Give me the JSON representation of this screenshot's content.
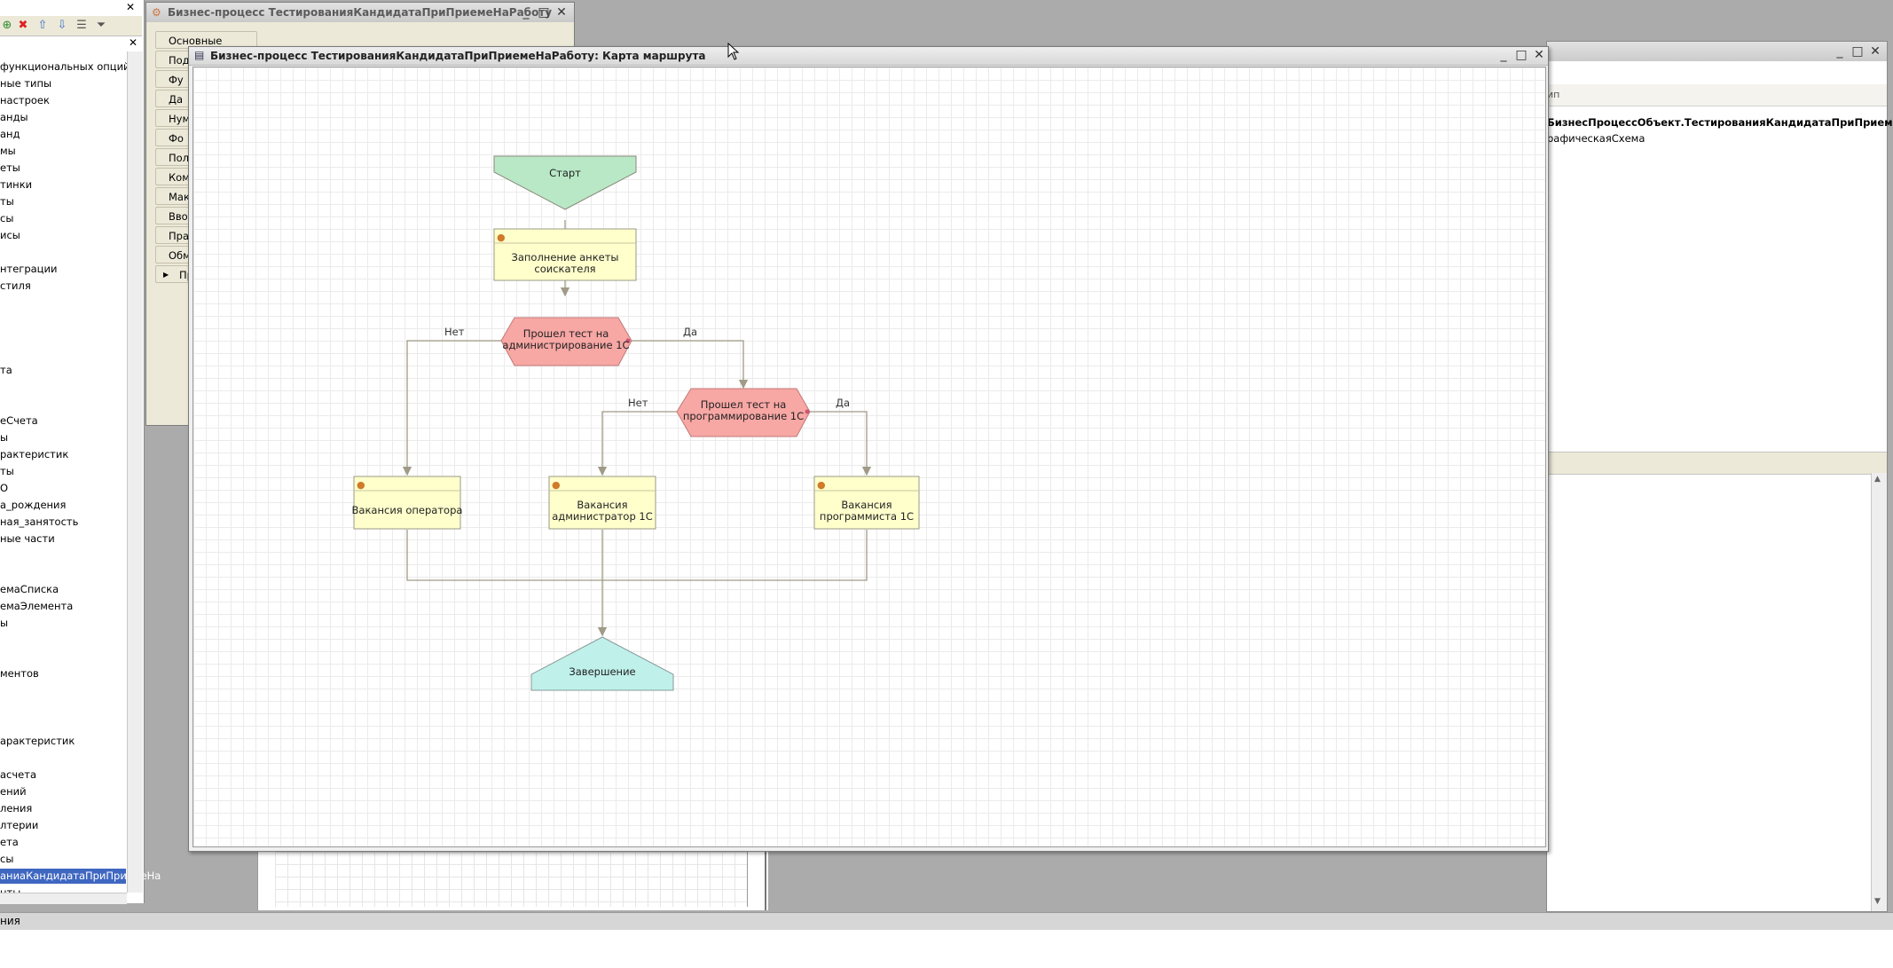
{
  "tree": {
    "items": [
      {
        "label": "функциональных опций"
      },
      {
        "label": "ные типы"
      },
      {
        "label": "настроек"
      },
      {
        "label": "анды"
      },
      {
        "label": "анд"
      },
      {
        "label": "мы"
      },
      {
        "label": "еты"
      },
      {
        "label": "тинки"
      },
      {
        "label": "ты"
      },
      {
        "label": "сы"
      },
      {
        "label": "исы"
      },
      {
        "label": "нтеграции"
      },
      {
        "label": "стиля"
      },
      {
        "label": "та"
      },
      {
        "label": "еСчета"
      },
      {
        "label": "ы"
      },
      {
        "label": "рактеристик"
      },
      {
        "label": "ты"
      },
      {
        "label": "О"
      },
      {
        "label": "а_рождения"
      },
      {
        "label": "ная_занятость"
      },
      {
        "label": "ные части"
      },
      {
        "label": "емаСписка"
      },
      {
        "label": "емаЭлемента"
      },
      {
        "label": "ы"
      },
      {
        "label": "ментов"
      },
      {
        "label": "арактеристик"
      },
      {
        "label": "асчета"
      },
      {
        "label": "ений"
      },
      {
        "label": "ления"
      },
      {
        "label": "лтерии"
      },
      {
        "label": "ета"
      },
      {
        "label": "сы"
      },
      {
        "label": "аниаКандидатаПриПриемеНа"
      },
      {
        "label": "нты"
      }
    ],
    "selected_index": 33
  },
  "status_bar": {
    "text": "ния"
  },
  "bg_window": {
    "title": "Бизнес-процесс ТестированияКандидатаПриПриемеНаРаботу",
    "tabs": [
      "Основные",
      "Под",
      "Фу",
      "Да",
      "Нум",
      "Фо",
      "Пол",
      "Ком",
      "Мак",
      "Вво",
      "Пра",
      "Обм",
      "Про"
    ]
  },
  "right_window": {
    "column_header": "ип",
    "rows": [
      "БизнесПроцессОбъект.ТестированияКандидатаПриПриемеН...",
      "рафическаяСхема"
    ]
  },
  "map_window": {
    "title": "Бизнес-процесс ТестированияКандидатаПриПриемеНаРаботу: Карта маршрута",
    "controls": {
      "minimize": "_",
      "maximize": "□",
      "close": "✕"
    }
  },
  "flowchart": {
    "start": "Старт",
    "fill_form": [
      "Заполнение анкеты",
      "соискателя"
    ],
    "cond_admin": [
      "Прошел тест на",
      "администрирование 1С"
    ],
    "cond_prog": [
      "Прошел тест на",
      "программирование 1С"
    ],
    "operator": "Вакансия оператора",
    "admin_vac": [
      "Вакансия",
      "администратор 1С"
    ],
    "prog_vac": [
      "Вакансия",
      "программиста 1С"
    ],
    "finish": "Завершение",
    "no": "Нет",
    "yes": "Да",
    "colors": {
      "start": "#b8e8c6",
      "task": "#ffffcc",
      "cond": "#f7a7a4",
      "finish": "#bff0ea",
      "line": "#a09a86"
    }
  }
}
